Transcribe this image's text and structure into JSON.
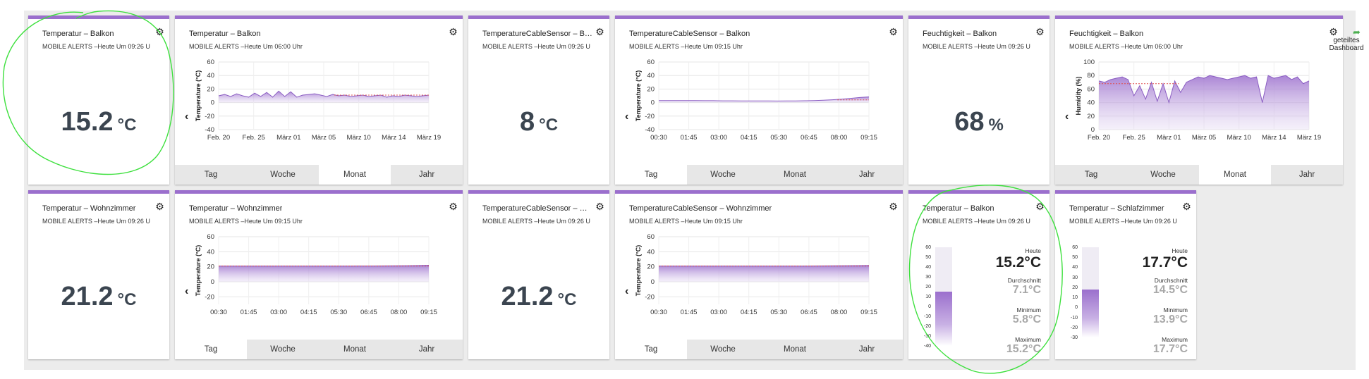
{
  "colors": {
    "accent": "#9b6fcd",
    "annotation": "#3ee03e",
    "dashed": "#e05050"
  },
  "shared_dashboard": {
    "label_line1": "geteiltes",
    "label_line2": "Dashboard",
    "icon": "share-arrow-icon"
  },
  "tabs": {
    "day": "Tag",
    "week": "Woche",
    "month": "Monat",
    "year": "Jahr"
  },
  "cards": {
    "temp_balkon_value": {
      "title": "Temperatur – Balkon",
      "subtitle": "MOBILE ALERTS –Heute Um 09:26 U",
      "value": "15.2",
      "unit": "°C"
    },
    "temp_balkon_month": {
      "title": "Temperatur – Balkon",
      "subtitle": "MOBILE ALERTS –Heute Um 06:00 Uhr",
      "active_tab": "month"
    },
    "cable_balkon_value": {
      "title": "TemperatureCableSensor – B…",
      "subtitle": "MOBILE ALERTS –Heute Um 09:26 U",
      "value": "8",
      "unit": "°C"
    },
    "cable_balkon_day": {
      "title": "TemperatureCableSensor – Balkon",
      "subtitle": "MOBILE ALERTS –Heute Um 09:15 Uhr",
      "active_tab": "day"
    },
    "hum_balkon_value": {
      "title": "Feuchtigkeit – Balkon",
      "subtitle": "MOBILE ALERTS –Heute Um 09:26 U",
      "value": "68",
      "unit": "%"
    },
    "hum_balkon_month": {
      "title": "Feuchtigkeit – Balkon",
      "subtitle": "MOBILE ALERTS –Heute Um 06:00 Uhr",
      "active_tab": "month"
    },
    "temp_wohn_value": {
      "title": "Temperatur – Wohnzimmer",
      "subtitle": "MOBILE ALERTS –Heute Um 09:26 U",
      "value": "21.2",
      "unit": "°C"
    },
    "temp_wohn_day": {
      "title": "Temperatur – Wohnzimmer",
      "subtitle": "MOBILE ALERTS –Heute Um 09:15 Uhr",
      "active_tab": "day"
    },
    "cable_wohn_value": {
      "title": "TemperatureCableSensor – W…",
      "subtitle": "MOBILE ALERTS –Heute Um 09:26 U",
      "value": "21.2",
      "unit": "°C"
    },
    "cable_wohn_day": {
      "title": "TemperatureCableSensor – Wohnzimmer",
      "subtitle": "MOBILE ALERTS –Heute Um 09:15 Uhr",
      "active_tab": "day"
    },
    "gauge_balkon": {
      "title": "Temperatur – Balkon",
      "subtitle": "MOBILE ALERTS –Heute Um 09:26 U",
      "level_value": 15.2,
      "ticks": [
        "60",
        "50",
        "40",
        "30",
        "20",
        "10",
        "0",
        "-10",
        "-20",
        "-30",
        "-40"
      ],
      "today_label": "Heute",
      "today_value": "15.2°C",
      "avg_label": "Durchschnitt",
      "avg_value": "7.1°C",
      "min_label": "Minimum",
      "min_value": "5.8°C",
      "max_label": "Maximum",
      "max_value": "15.2°C"
    },
    "gauge_schlaf": {
      "title": "Temperatur – Schlafzimmer",
      "subtitle": "MOBILE ALERTS –Heute Um 09:26 U",
      "level_value": 17.7,
      "ticks": [
        "60",
        "50",
        "40",
        "30",
        "20",
        "10",
        "0",
        "-10",
        "-20",
        "-30"
      ],
      "today_label": "Heute",
      "today_value": "17.7°C",
      "avg_label": "Durchschnitt",
      "avg_value": "14.5°C",
      "min_label": "Minimum",
      "min_value": "13.9°C",
      "max_label": "Maximum",
      "max_value": "17.7°C"
    }
  },
  "chart_data": [
    {
      "id": "temp_balkon_month",
      "type": "area",
      "ylabel": "Temperature (°C)",
      "ylim": [
        -40,
        60
      ],
      "yticks": [
        "60",
        "40",
        "20",
        "0",
        "-20",
        "-40"
      ],
      "xticks": [
        "Feb. 20",
        "Feb. 25",
        "März 01",
        "März 05",
        "März 10",
        "März 14",
        "März 19"
      ],
      "series": [
        {
          "values": [
            10,
            12,
            9,
            13,
            10,
            8,
            14,
            9,
            15,
            8,
            17,
            9,
            16,
            8,
            11,
            12,
            13,
            11,
            9,
            12,
            10,
            11,
            9,
            10,
            11,
            9,
            10,
            11,
            8,
            10,
            9,
            11,
            10,
            9,
            10,
            11
          ]
        }
      ],
      "dashed_line": {
        "from": 0.55,
        "to": 1.0,
        "value": 11
      }
    },
    {
      "id": "cable_balkon_day",
      "type": "area",
      "ylabel": "Temperature (°C)",
      "ylim": [
        -40,
        60
      ],
      "yticks": [
        "60",
        "40",
        "20",
        "0",
        "-20",
        "-40"
      ],
      "xticks": [
        "00:30",
        "01:45",
        "03:00",
        "04:15",
        "05:30",
        "06:45",
        "08:00",
        "09:15"
      ],
      "series": [
        {
          "values": [
            3,
            3,
            3,
            3,
            3,
            2.8,
            2.8,
            2.6,
            2.6,
            2.5,
            2.4,
            2.4,
            2.4,
            2.3,
            2.4,
            2.5,
            2.7,
            3,
            3.5,
            4.2,
            5,
            6.2,
            7.5,
            8.5
          ]
        }
      ],
      "dashed_line": {
        "from": 0.85,
        "to": 1.0,
        "value": 4
      }
    },
    {
      "id": "hum_balkon_month",
      "type": "area",
      "ylabel": "Humidity (%)",
      "ylim": [
        0,
        100
      ],
      "yticks": [
        "100",
        "80",
        "60",
        "40",
        "20",
        "0"
      ],
      "xticks": [
        "Feb. 20",
        "Feb. 25",
        "März 01",
        "März 05",
        "März 10",
        "März 14",
        "März 19"
      ],
      "series": [
        {
          "values": [
            72,
            70,
            74,
            76,
            78,
            74,
            50,
            65,
            45,
            70,
            42,
            68,
            40,
            72,
            55,
            70,
            74,
            78,
            76,
            80,
            78,
            76,
            74,
            76,
            78,
            80,
            76,
            78,
            40,
            80,
            76,
            78,
            80,
            74,
            78,
            68,
            72
          ]
        }
      ],
      "dashed_line": {
        "from": 0.0,
        "to": 0.38,
        "value": 68
      }
    },
    {
      "id": "temp_wohn_day",
      "type": "area",
      "ylabel": "Temperature (°C)",
      "ylim": [
        -30,
        60
      ],
      "yticks": [
        "60",
        "40",
        "20",
        "0",
        "-20"
      ],
      "xticks": [
        "00:30",
        "01:45",
        "03:00",
        "04:15",
        "05:30",
        "06:45",
        "08:00",
        "09:15"
      ],
      "series": [
        {
          "values": [
            21,
            21,
            21,
            21,
            21,
            21,
            21,
            21,
            21,
            21,
            21,
            21,
            21,
            21.1,
            21.1,
            21.2,
            21.3,
            21.5,
            21.7,
            22
          ]
        }
      ],
      "dashed_line": {
        "from": 0.0,
        "to": 1.0,
        "value": 21
      }
    },
    {
      "id": "cable_wohn_day",
      "type": "area",
      "ylabel": "Temperature (°C)",
      "ylim": [
        -30,
        60
      ],
      "yticks": [
        "60",
        "40",
        "20",
        "0",
        "-20"
      ],
      "xticks": [
        "00:30",
        "01:45",
        "03:00",
        "04:15",
        "05:30",
        "06:45",
        "08:00",
        "09:15"
      ],
      "series": [
        {
          "values": [
            21,
            21,
            21,
            21,
            21,
            21,
            21,
            21,
            21,
            21,
            21,
            21,
            21,
            21,
            21.1,
            21.2,
            21.3,
            21.4,
            21.6,
            21.8
          ]
        }
      ],
      "dashed_line": {
        "from": 0.0,
        "to": 1.0,
        "value": 21
      }
    }
  ]
}
